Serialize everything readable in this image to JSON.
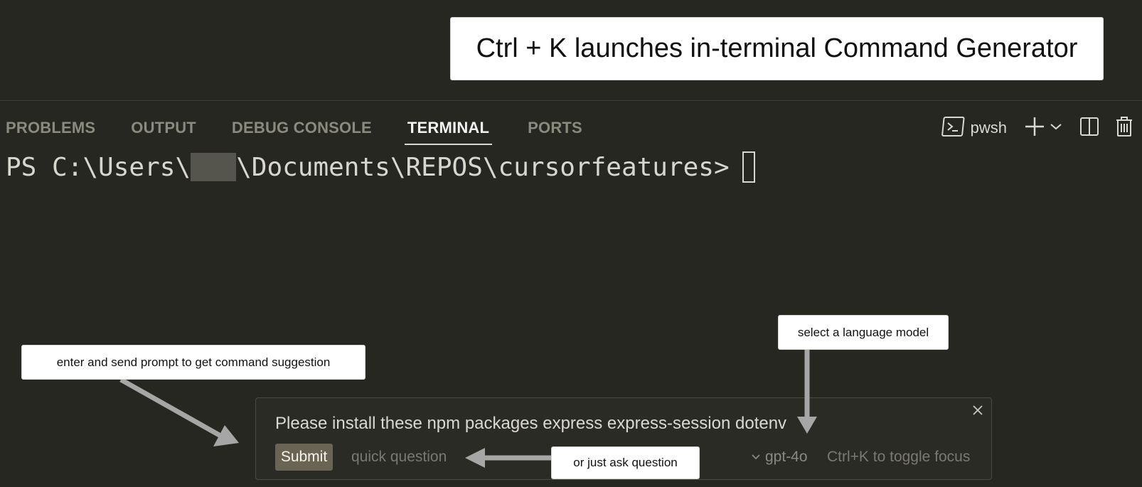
{
  "annotations": {
    "main": "Ctrl + K  launches in-terminal Command Generator",
    "prompt_hint": "enter and send prompt to get command suggestion",
    "model_hint": "select a language model",
    "question_hint": "or just ask question"
  },
  "panel": {
    "tabs": [
      {
        "label": "PROBLEMS",
        "active": false
      },
      {
        "label": "OUTPUT",
        "active": false
      },
      {
        "label": "DEBUG CONSOLE",
        "active": false
      },
      {
        "label": "TERMINAL",
        "active": true
      },
      {
        "label": "PORTS",
        "active": false
      }
    ],
    "shell": "pwsh",
    "icons": [
      "terminal-icon",
      "plus-icon",
      "chevron-down-icon",
      "split-icon",
      "trash-icon"
    ]
  },
  "terminal": {
    "prompt_prefix": "PS C:\\Users\\",
    "prompt_suffix": "\\Documents\\REPOS\\cursorfeatures>"
  },
  "command_generator": {
    "prompt_text": "Please install these npm packages express express-session dotenv",
    "submit_label": "Submit",
    "quick_label": "quick question",
    "model": "gpt-4o",
    "toggle_hint": "Ctrl+K to toggle focus"
  },
  "colors": {
    "background": "#272721",
    "tab_inactive": "#8b8a7e",
    "tab_active": "#f2f2f2",
    "submit_bg": "#6a6454",
    "arrow": "#a6a6a6"
  }
}
